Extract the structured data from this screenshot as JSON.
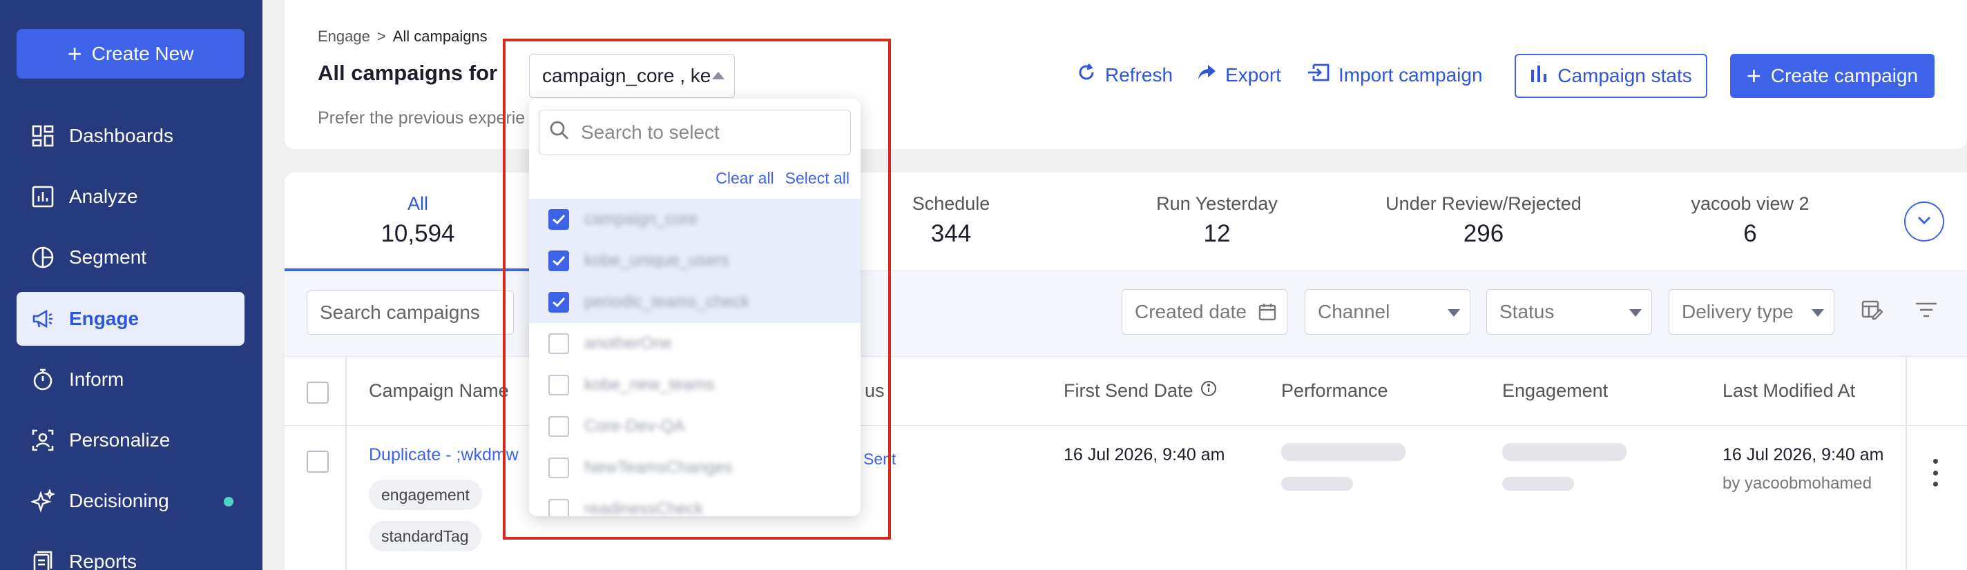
{
  "sidebar": {
    "create_new": "Create New",
    "items": [
      {
        "label": "Dashboards",
        "icon": "dashboard-icon"
      },
      {
        "label": "Analyze",
        "icon": "bar-chart-icon"
      },
      {
        "label": "Segment",
        "icon": "pie-chart-icon"
      },
      {
        "label": "Engage",
        "icon": "megaphone-icon",
        "active": true
      },
      {
        "label": "Inform",
        "icon": "stopwatch-icon"
      },
      {
        "label": "Personalize",
        "icon": "user-frame-icon"
      },
      {
        "label": "Decisioning",
        "icon": "sparkle-icon",
        "badge_color": "#4fd1c5"
      },
      {
        "label": "Reports",
        "icon": "report-icon"
      }
    ]
  },
  "header": {
    "breadcrumb": {
      "root": "Engage",
      "sep": ">",
      "current": "All campaigns"
    },
    "title": "All campaigns for",
    "prefer_text": "Prefer the previous experie",
    "select_value": "campaign_core , kе",
    "actions": {
      "refresh": "Refresh",
      "export": "Export",
      "import": "Import campaign",
      "stats": "Campaign stats",
      "create": "Create campaign"
    }
  },
  "dropdown": {
    "search_placeholder": "Search to select",
    "clear_all": "Clear all",
    "select_all": "Select all",
    "options": [
      {
        "label": "campaign_core",
        "checked": true
      },
      {
        "label": "kobe_unique_users",
        "checked": true
      },
      {
        "label": "periodic_teams_check",
        "checked": true
      },
      {
        "label": "anotherOne",
        "checked": false
      },
      {
        "label": "kobe_new_teams",
        "checked": false
      },
      {
        "label": "Core-Dev-QA",
        "checked": false
      },
      {
        "label": "NewTeamsChanges",
        "checked": false
      },
      {
        "label": "readinessCheck",
        "checked": false
      }
    ]
  },
  "tabs": [
    {
      "label": "All",
      "value": "10,594",
      "active": true
    },
    {
      "label": "Schedule",
      "value": "344"
    },
    {
      "label": "Run Yesterday",
      "value": "12"
    },
    {
      "label": "Under Review/Rejected",
      "value": "296"
    },
    {
      "label": "yacoob view 2",
      "value": "6"
    }
  ],
  "filters": {
    "search_placeholder": "Search campaigns",
    "created_date": "Created date",
    "channel": "Channel",
    "status": "Status",
    "delivery_type": "Delivery type"
  },
  "table": {
    "columns": {
      "name": "Campaign Name",
      "status_partial": "us",
      "first_send": "First Send Date",
      "performance": "Performance",
      "engagement": "Engagement",
      "last_modified": "Last Modified At"
    },
    "rows": [
      {
        "name": "Duplicate - ;wkdmw",
        "tags": [
          "engagement",
          "standardTag"
        ],
        "status": "Sent",
        "first_send": "16 Jul 2026, 9:40 am",
        "last_modified": "16 Jul 2026, 9:40 am",
        "modified_by": "by yacoobmohamed"
      }
    ]
  },
  "colors": {
    "sidebar": "#263b7d",
    "accent": "#3e63e8",
    "highlight": "#d42a22"
  }
}
